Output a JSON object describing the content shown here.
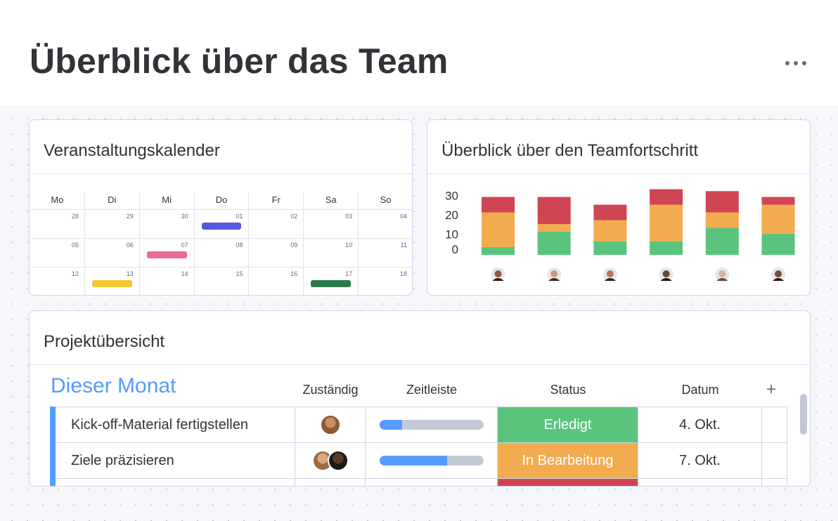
{
  "header": {
    "title": "Überblick über das Team"
  },
  "calendar": {
    "title": "Veranstaltungskalender",
    "weekdays": [
      "Mo",
      "Di",
      "Mi",
      "Do",
      "Fr",
      "Sa",
      "So"
    ],
    "weeks": [
      [
        "28",
        "29",
        "30",
        "01",
        "02",
        "03",
        "04"
      ],
      [
        "05",
        "06",
        "07",
        "08",
        "09",
        "10",
        "11"
      ],
      [
        "12",
        "13",
        "14",
        "15",
        "16",
        "17",
        "18"
      ]
    ],
    "events": [
      {
        "week": 0,
        "day": 3,
        "color": "#5559df"
      },
      {
        "week": 1,
        "day": 2,
        "color": "#e8699a"
      },
      {
        "week": 2,
        "day": 1,
        "color": "#f5c730"
      },
      {
        "week": 2,
        "day": 5,
        "color": "#2b7a4b"
      }
    ]
  },
  "progress": {
    "title": "Überblick über den Teamfortschritt",
    "colors": {
      "done": "#5ac47d",
      "working": "#f2ac4f",
      "stuck": "#d04554"
    },
    "members": [
      "avatar-1",
      "avatar-2",
      "avatar-3",
      "avatar-4",
      "avatar-5",
      "avatar-6"
    ]
  },
  "chart_data": {
    "type": "bar",
    "stacked": true,
    "categories": [
      "",
      "",
      "",
      "",
      "",
      ""
    ],
    "series": [
      {
        "color": "#5ac47d",
        "values": [
          4,
          12,
          7,
          7,
          14,
          11
        ]
      },
      {
        "color": "#f2ac4f",
        "values": [
          18,
          4,
          11,
          19,
          8,
          15
        ]
      },
      {
        "color": "#d04554",
        "values": [
          8,
          14,
          8,
          8,
          11,
          4
        ]
      }
    ],
    "yticks": [
      "30",
      "20",
      "10",
      "0"
    ],
    "ylim": [
      0,
      35
    ]
  },
  "projects": {
    "title": "Projektübersicht",
    "group": "Dieser Monat",
    "columns": {
      "owner": "Zuständig",
      "timeline": "Zeitleiste",
      "status": "Status",
      "date": "Datum",
      "add": "+"
    },
    "rows": [
      {
        "name": "Kick-off-Material fertigstellen",
        "status": "Erledigt",
        "status_color": "#5ac47d",
        "date": "4. Okt.",
        "timeline_progress": 0.22
      },
      {
        "name": "Ziele präzisieren",
        "status": "In Bearbeitung",
        "status_color": "#f2ac4f",
        "date": "7. Okt.",
        "timeline_progress": 0.65
      },
      {
        "name": "",
        "status": "",
        "status_color": "#d04554",
        "date": "",
        "timeline_progress": 0
      }
    ]
  }
}
